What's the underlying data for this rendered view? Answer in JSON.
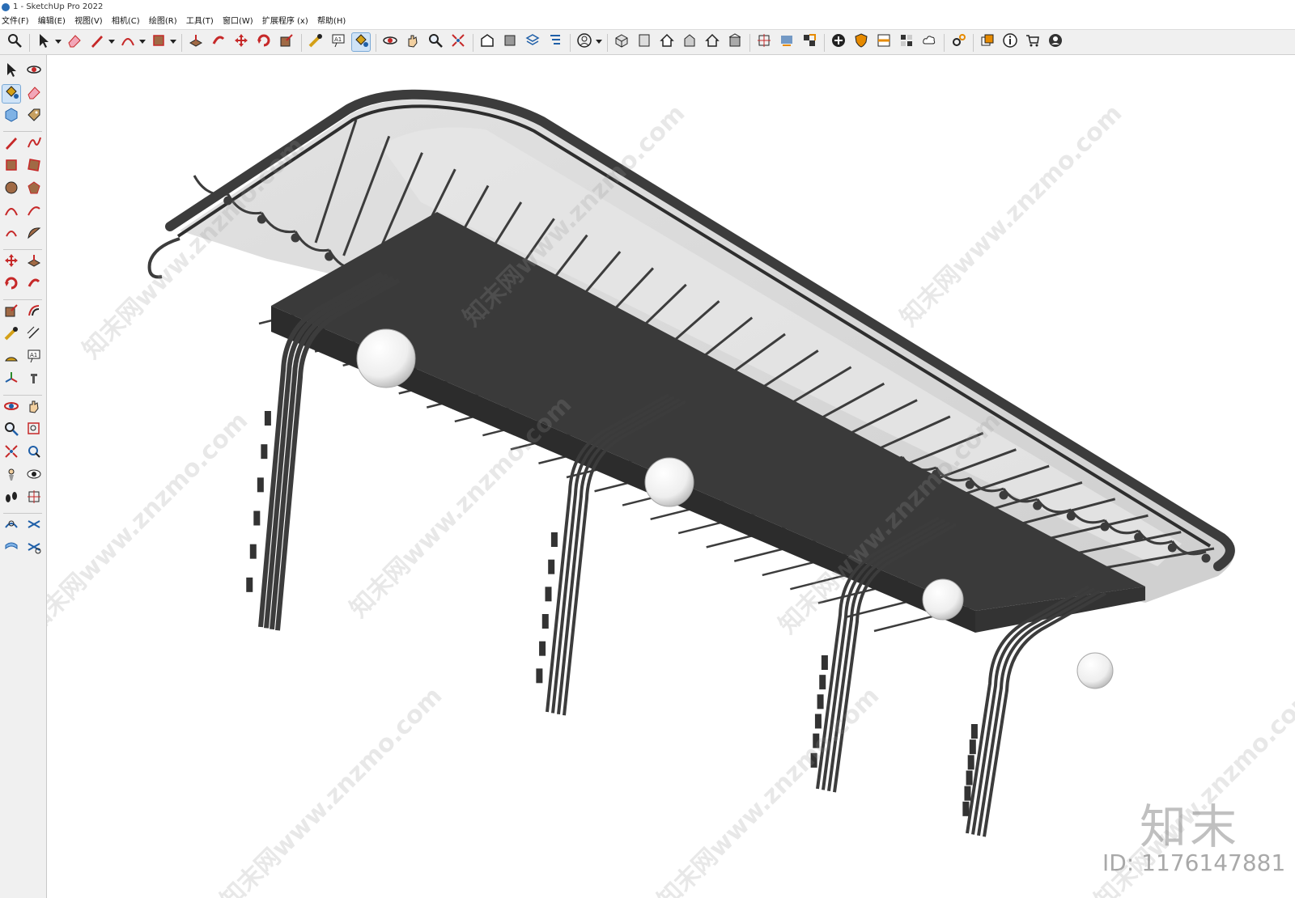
{
  "window": {
    "title": "1 - SketchUp Pro 2022"
  },
  "menu": {
    "items": [
      "文件(F)",
      "编辑(E)",
      "视图(V)",
      "相机(C)",
      "绘图(R)",
      "工具(T)",
      "窗口(W)",
      "扩展程序 (x)",
      "帮助(H)"
    ]
  },
  "toolbar": {
    "active_tool": "paint-bucket",
    "groups": [
      [
        "search-icon"
      ],
      [
        "select-icon",
        "eraser-icon",
        "pencil-icon",
        "arc-icon",
        "rectangle-icon"
      ],
      [
        "push-pull-icon",
        "follow-me-icon",
        "move-icon",
        "rotate-icon",
        "scale-icon"
      ],
      [
        "tape-measure-icon",
        "text-icon",
        "paint-bucket-icon"
      ],
      [
        "orbit-icon",
        "pan-icon",
        "zoom-icon",
        "zoom-extents-icon"
      ],
      [
        "warehouse-icon",
        "extension-icon",
        "layers-icon",
        "outliner-icon"
      ],
      [
        "user-icon"
      ],
      [
        "iso-view-icon",
        "front-view-icon",
        "home-view-icon",
        "back-view-icon",
        "top-view-icon",
        "right-view-icon"
      ],
      [
        "section-plane-icon",
        "section-display-icon",
        "section-cut-icon"
      ],
      [
        "add-icon",
        "shield-icon",
        "styles-icon",
        "texture-icon",
        "cloud-icon"
      ],
      [
        "settings-icon"
      ],
      [
        "scenes-icon",
        "info-icon",
        "cart-icon",
        "account-icon"
      ]
    ]
  },
  "sidebar": {
    "tools": [
      [
        "select-icon",
        "orbit-icon"
      ],
      [
        "paint-bucket-icon",
        "eraser-icon"
      ],
      [
        "component-icon",
        "tag-icon"
      ],
      [
        "line-icon",
        "freehand-icon"
      ],
      [
        "rectangle-icon",
        "rotated-rectangle-icon"
      ],
      [
        "circle-icon",
        "polygon-icon"
      ],
      [
        "arc-icon",
        "two-point-arc-icon"
      ],
      [
        "three-point-arc-icon",
        "pie-icon"
      ],
      [
        "move-icon",
        "push-pull-icon"
      ],
      [
        "rotate-icon",
        "follow-me-icon"
      ],
      [
        "scale-icon",
        "offset-icon"
      ],
      [
        "tape-measure-icon",
        "dimension-icon"
      ],
      [
        "protractor-icon",
        "text-icon"
      ],
      [
        "axes-icon",
        "3d-text-icon"
      ],
      [
        "orbit-tool-icon",
        "pan-tool-icon"
      ],
      [
        "zoom-tool-icon",
        "zoom-window-icon"
      ],
      [
        "zoom-extents-icon",
        "previous-view-icon"
      ],
      [
        "position-camera-icon",
        "look-around-icon"
      ],
      [
        "walk-icon",
        "section-plane-icon"
      ],
      [
        "sandbox-smoove-icon",
        "sandbox-stamp-icon"
      ],
      [
        "sandbox-drape-icon",
        "sandbox-flip-icon"
      ]
    ]
  },
  "viewport": {
    "watermark_text": "知末网www.znzmo.com",
    "brand_logo": "知末",
    "image_id": "ID: 1176147881"
  },
  "colors": {
    "frame": "#3c3c3c",
    "frame_dark": "#2a2a2a",
    "glass": "#d7d7d7",
    "globe": "#f2f2f2",
    "toolbar_bg": "#f0f0f0",
    "active_tool_bg": "#cfe3f7"
  }
}
